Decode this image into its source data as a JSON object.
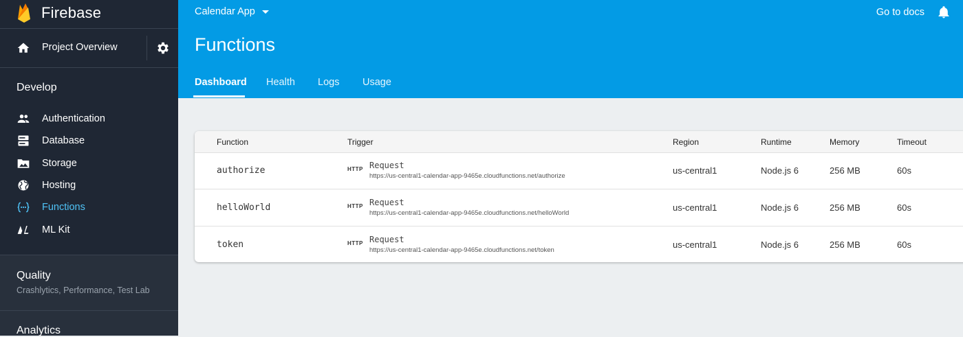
{
  "app": {
    "name": "Firebase"
  },
  "sidebar": {
    "project_overview": "Project Overview",
    "develop": {
      "title": "Develop",
      "items": [
        {
          "label": "Authentication",
          "icon": "people-icon"
        },
        {
          "label": "Database",
          "icon": "database-icon"
        },
        {
          "label": "Storage",
          "icon": "photo-icon"
        },
        {
          "label": "Hosting",
          "icon": "globe-icon"
        },
        {
          "label": "Functions",
          "icon": "functions-icon",
          "active": true
        },
        {
          "label": "ML Kit",
          "icon": "mlkit-icon"
        }
      ]
    },
    "quality": {
      "title": "Quality",
      "subtitle": "Crashlytics, Performance, Test Lab"
    },
    "analytics": {
      "title": "Analytics"
    }
  },
  "header": {
    "project": "Calendar App",
    "docs": "Go to docs",
    "title": "Functions",
    "tabs": [
      {
        "label": "Dashboard",
        "active": true
      },
      {
        "label": "Health"
      },
      {
        "label": "Logs"
      },
      {
        "label": "Usage"
      }
    ]
  },
  "table": {
    "columns": [
      "Function",
      "Trigger",
      "Region",
      "Runtime",
      "Memory",
      "Timeout"
    ],
    "rows": [
      {
        "function": "authorize",
        "trigger_type": "HTTP",
        "trigger": "Request",
        "url": "https://us-central1-calendar-app-9465e.cloudfunctions.net/authorize",
        "region": "us-central1",
        "runtime": "Node.js 6",
        "memory": "256 MB",
        "timeout": "60s"
      },
      {
        "function": "helloWorld",
        "trigger_type": "HTTP",
        "trigger": "Request",
        "url": "https://us-central1-calendar-app-9465e.cloudfunctions.net/helloWorld",
        "region": "us-central1",
        "runtime": "Node.js 6",
        "memory": "256 MB",
        "timeout": "60s"
      },
      {
        "function": "token",
        "trigger_type": "HTTP",
        "trigger": "Request",
        "url": "https://us-central1-calendar-app-9465e.cloudfunctions.net/token",
        "region": "us-central1",
        "runtime": "Node.js 6",
        "memory": "256 MB",
        "timeout": "60s"
      }
    ]
  },
  "colors": {
    "sidebar": "#1f2734",
    "header": "#039be5",
    "active_nav": "#4fc3f7",
    "background": "#eceff1"
  }
}
